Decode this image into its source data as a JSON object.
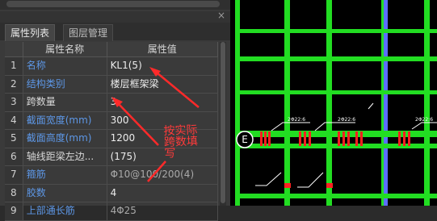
{
  "panel": {
    "close_glyph": "×",
    "tabs": [
      {
        "label": "属性列表"
      },
      {
        "label": "图层管理"
      }
    ],
    "headers": [
      "属性名称",
      "属性值"
    ],
    "rows": [
      {
        "num": "1",
        "name": "名称",
        "value": "KL1(5)"
      },
      {
        "num": "2",
        "name": "结构类别",
        "value": "楼层框架梁"
      },
      {
        "num": "3",
        "name": "跨数量",
        "value": "3"
      },
      {
        "num": "4",
        "name": "截面宽度(mm)",
        "value": "300"
      },
      {
        "num": "5",
        "name": "截面高度(mm)",
        "value": "1200"
      },
      {
        "num": "6",
        "name": "轴线距梁左边...",
        "value": "(175)"
      },
      {
        "num": "7",
        "name": "箍筋",
        "value": "Φ10@100/200(4)"
      },
      {
        "num": "8",
        "name": "胶数",
        "value": "4"
      },
      {
        "num": "9",
        "name": "上部通长筋",
        "value": "4Φ25"
      }
    ]
  },
  "annotation": {
    "lines": [
      "按实际",
      "跨数填",
      "写"
    ]
  },
  "drawing": {
    "axis_label": "E",
    "rebar_labels": [
      "2Φ22:6",
      "2Φ22:6",
      "2Φ22:6"
    ]
  },
  "colors": {
    "beam": "#22dd22",
    "axis": "#5b6fff",
    "rebar_mark": "#ff2020",
    "annotation": "#ff3a3a",
    "blue_label": "#5d97e6"
  }
}
